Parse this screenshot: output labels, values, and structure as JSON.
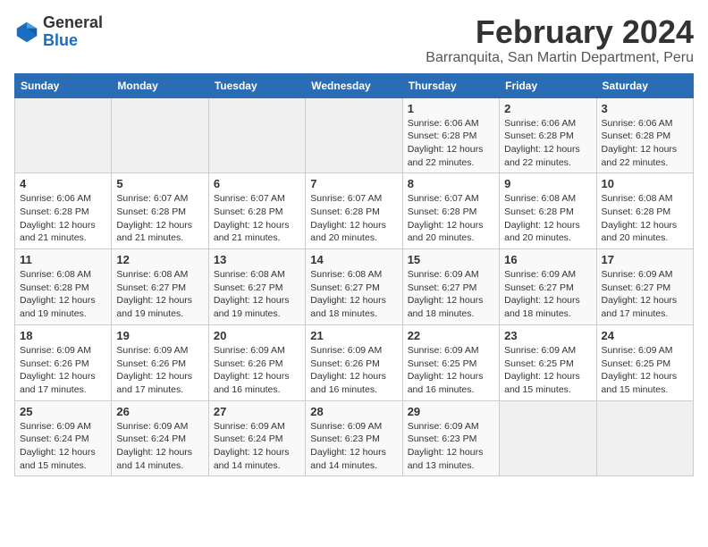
{
  "header": {
    "logo_general": "General",
    "logo_blue": "Blue",
    "month_title": "February 2024",
    "location": "Barranquita, San Martin Department, Peru"
  },
  "days_of_week": [
    "Sunday",
    "Monday",
    "Tuesday",
    "Wednesday",
    "Thursday",
    "Friday",
    "Saturday"
  ],
  "weeks": [
    [
      {
        "day": "",
        "info": ""
      },
      {
        "day": "",
        "info": ""
      },
      {
        "day": "",
        "info": ""
      },
      {
        "day": "",
        "info": ""
      },
      {
        "day": "1",
        "info": "Sunrise: 6:06 AM\nSunset: 6:28 PM\nDaylight: 12 hours\nand 22 minutes."
      },
      {
        "day": "2",
        "info": "Sunrise: 6:06 AM\nSunset: 6:28 PM\nDaylight: 12 hours\nand 22 minutes."
      },
      {
        "day": "3",
        "info": "Sunrise: 6:06 AM\nSunset: 6:28 PM\nDaylight: 12 hours\nand 22 minutes."
      }
    ],
    [
      {
        "day": "4",
        "info": "Sunrise: 6:06 AM\nSunset: 6:28 PM\nDaylight: 12 hours\nand 21 minutes."
      },
      {
        "day": "5",
        "info": "Sunrise: 6:07 AM\nSunset: 6:28 PM\nDaylight: 12 hours\nand 21 minutes."
      },
      {
        "day": "6",
        "info": "Sunrise: 6:07 AM\nSunset: 6:28 PM\nDaylight: 12 hours\nand 21 minutes."
      },
      {
        "day": "7",
        "info": "Sunrise: 6:07 AM\nSunset: 6:28 PM\nDaylight: 12 hours\nand 20 minutes."
      },
      {
        "day": "8",
        "info": "Sunrise: 6:07 AM\nSunset: 6:28 PM\nDaylight: 12 hours\nand 20 minutes."
      },
      {
        "day": "9",
        "info": "Sunrise: 6:08 AM\nSunset: 6:28 PM\nDaylight: 12 hours\nand 20 minutes."
      },
      {
        "day": "10",
        "info": "Sunrise: 6:08 AM\nSunset: 6:28 PM\nDaylight: 12 hours\nand 20 minutes."
      }
    ],
    [
      {
        "day": "11",
        "info": "Sunrise: 6:08 AM\nSunset: 6:28 PM\nDaylight: 12 hours\nand 19 minutes."
      },
      {
        "day": "12",
        "info": "Sunrise: 6:08 AM\nSunset: 6:27 PM\nDaylight: 12 hours\nand 19 minutes."
      },
      {
        "day": "13",
        "info": "Sunrise: 6:08 AM\nSunset: 6:27 PM\nDaylight: 12 hours\nand 19 minutes."
      },
      {
        "day": "14",
        "info": "Sunrise: 6:08 AM\nSunset: 6:27 PM\nDaylight: 12 hours\nand 18 minutes."
      },
      {
        "day": "15",
        "info": "Sunrise: 6:09 AM\nSunset: 6:27 PM\nDaylight: 12 hours\nand 18 minutes."
      },
      {
        "day": "16",
        "info": "Sunrise: 6:09 AM\nSunset: 6:27 PM\nDaylight: 12 hours\nand 18 minutes."
      },
      {
        "day": "17",
        "info": "Sunrise: 6:09 AM\nSunset: 6:27 PM\nDaylight: 12 hours\nand 17 minutes."
      }
    ],
    [
      {
        "day": "18",
        "info": "Sunrise: 6:09 AM\nSunset: 6:26 PM\nDaylight: 12 hours\nand 17 minutes."
      },
      {
        "day": "19",
        "info": "Sunrise: 6:09 AM\nSunset: 6:26 PM\nDaylight: 12 hours\nand 17 minutes."
      },
      {
        "day": "20",
        "info": "Sunrise: 6:09 AM\nSunset: 6:26 PM\nDaylight: 12 hours\nand 16 minutes."
      },
      {
        "day": "21",
        "info": "Sunrise: 6:09 AM\nSunset: 6:26 PM\nDaylight: 12 hours\nand 16 minutes."
      },
      {
        "day": "22",
        "info": "Sunrise: 6:09 AM\nSunset: 6:25 PM\nDaylight: 12 hours\nand 16 minutes."
      },
      {
        "day": "23",
        "info": "Sunrise: 6:09 AM\nSunset: 6:25 PM\nDaylight: 12 hours\nand 15 minutes."
      },
      {
        "day": "24",
        "info": "Sunrise: 6:09 AM\nSunset: 6:25 PM\nDaylight: 12 hours\nand 15 minutes."
      }
    ],
    [
      {
        "day": "25",
        "info": "Sunrise: 6:09 AM\nSunset: 6:24 PM\nDaylight: 12 hours\nand 15 minutes."
      },
      {
        "day": "26",
        "info": "Sunrise: 6:09 AM\nSunset: 6:24 PM\nDaylight: 12 hours\nand 14 minutes."
      },
      {
        "day": "27",
        "info": "Sunrise: 6:09 AM\nSunset: 6:24 PM\nDaylight: 12 hours\nand 14 minutes."
      },
      {
        "day": "28",
        "info": "Sunrise: 6:09 AM\nSunset: 6:23 PM\nDaylight: 12 hours\nand 14 minutes."
      },
      {
        "day": "29",
        "info": "Sunrise: 6:09 AM\nSunset: 6:23 PM\nDaylight: 12 hours\nand 13 minutes."
      },
      {
        "day": "",
        "info": ""
      },
      {
        "day": "",
        "info": ""
      }
    ]
  ]
}
